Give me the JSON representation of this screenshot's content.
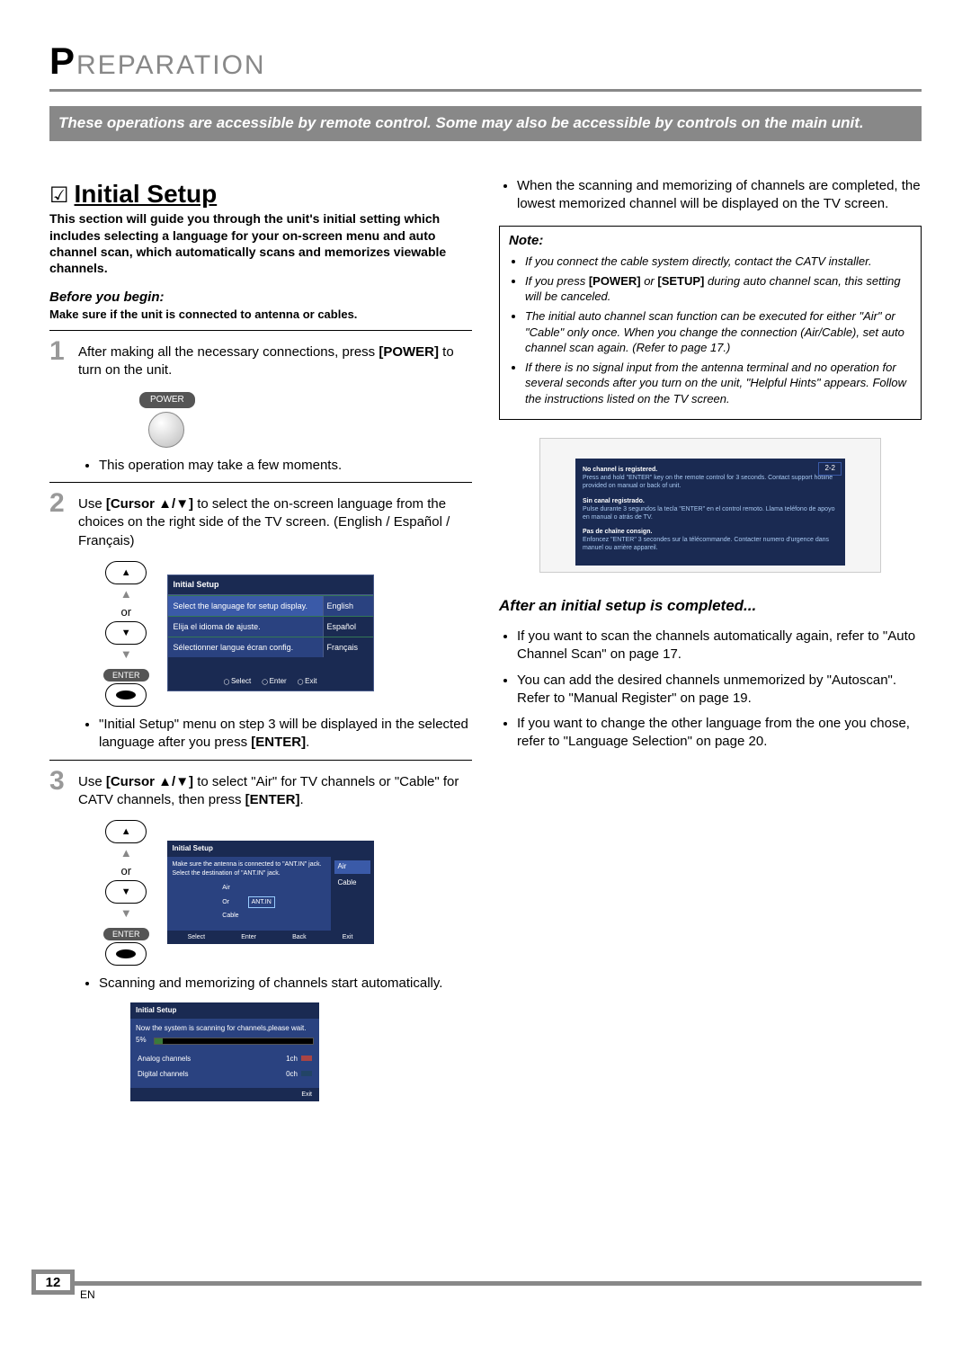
{
  "header": {
    "prefix": "P",
    "title": "REPARATION"
  },
  "banner": "These operations are accessible by remote control. Some may also be accessible by controls on the main unit.",
  "section": {
    "check": "☑",
    "title": "Initial Setup",
    "intro": "This section will guide you through the unit's initial setting which includes selecting a language for your on-screen menu and auto channel scan, which automatically scans and memorizes viewable channels.",
    "before_label": "Before you begin:",
    "before_text": "Make sure if the unit is connected to antenna or cables."
  },
  "steps": {
    "s1": {
      "num": "1",
      "text_a": "After making all the necessary connections, press ",
      "power": "[POWER]",
      "text_b": " to turn on the unit.",
      "power_label": "POWER",
      "bullet": "This operation may take a few moments."
    },
    "s2": {
      "num": "2",
      "text_a": "Use ",
      "cursor": "[Cursor ▲/▼]",
      "text_b": " to select the on-screen language from the choices on the right side of the TV screen. (English / Español / Français)",
      "or": "or",
      "enter": "ENTER",
      "osd_title": "Initial Setup",
      "osd_rows": [
        {
          "l": "Select the language for setup display.",
          "r": "English"
        },
        {
          "l": "Elija el idioma de ajuste.",
          "r": "Español"
        },
        {
          "l": "Sélectionner langue écran config.",
          "r": "Français"
        }
      ],
      "osd_foot": [
        "Select",
        "Enter",
        "Exit"
      ],
      "bullet_a": "\"Initial Setup\" menu on step 3 will be displayed in the selected language after you press ",
      "bullet_enter": "[ENTER]",
      "bullet_b": "."
    },
    "s3": {
      "num": "3",
      "text_a": "Use ",
      "cursor": "[Cursor ▲/▼]",
      "text_b": " to select \"Air\" for TV channels or \"Cable\" for CATV channels, then press ",
      "enter": "[ENTER]",
      "text_c": ".",
      "or": "or",
      "enter_lbl": "ENTER",
      "osd_title": "Initial Setup",
      "osd_msg1": "Make sure the antenna is connected to \"ANT.IN\" jack.",
      "osd_msg2": "Select the destination of \"ANT.IN\" jack.",
      "opt_air": "Air",
      "opt_cable": "Cable",
      "diag_air": "Air",
      "diag_or": "Or",
      "diag_cable": "Cable",
      "diag_ant": "ANT.IN",
      "osd_foot": [
        "Select",
        "Enter",
        "Back",
        "Exit"
      ],
      "bullet": "Scanning and memorizing of channels start automatically.",
      "scan_title": "Initial Setup",
      "scan_msg": "Now the system is scanning for channels,please wait.",
      "scan_pct": "5%",
      "scan_analog_l": "Analog channels",
      "scan_analog_v": "1ch",
      "scan_digital_l": "Digital channels",
      "scan_digital_v": "0ch",
      "scan_exit": "Exit"
    }
  },
  "right": {
    "top_bullet": "When the scanning and memorizing of channels are completed, the lowest memorized channel will be displayed on the TV screen.",
    "note_h": "Note:",
    "notes": [
      "If you connect the cable system directly, contact the CATV installer.",
      "If you press [POWER] or [SETUP] during auto channel scan, this setting will be canceled.",
      "The initial auto channel scan function can be executed for either \"Air\" or \"Cable\" only once. When you change the connection (Air/Cable), set auto channel scan again. (Refer to page 17.)",
      "If there is no signal input from the antenna terminal and no operation for several seconds after you turn on the unit, \"Helpful Hints\" appears. Follow the instructions listed on the TV screen."
    ],
    "hint_ch": "2-2",
    "hint_lines": [
      {
        "t": "No channel is registered.",
        "s": "Press and hold \"ENTER\" key on the remote control for 3 seconds. Contact support hotline provided on manual or back of unit."
      },
      {
        "t": "Sin canal registrado.",
        "s": "Pulse durante 3 segundos la tecla \"ENTER\" en el control remoto. Llama teléfono de apoyo en manual o atrás de TV."
      },
      {
        "t": "Pas de chaîne consign.",
        "s": "Enfoncez \"ENTER\" 3 secondes sur la télécommande. Contacter numero d'urgence dans manuel ou arrière appareil."
      }
    ],
    "after_h": "After an initial setup is completed...",
    "after_bullets": [
      "If you want to scan the channels automatically again, refer to \"Auto Channel Scan\" on page 17.",
      "You can add the desired channels unmemorized by \"Autoscan\". Refer to \"Manual Register\" on page 19.",
      "If you want to change the other language from the one you chose, refer to \"Language Selection\" on page 20."
    ]
  },
  "footer": {
    "page": "12",
    "lang": "EN"
  }
}
